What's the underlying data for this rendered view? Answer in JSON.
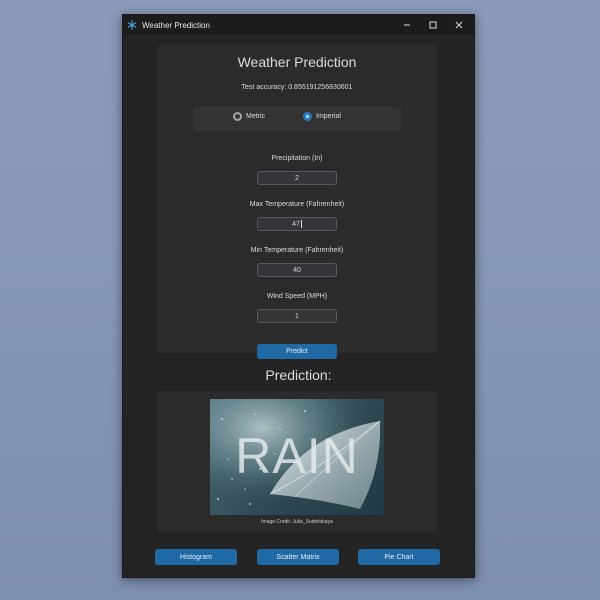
{
  "window": {
    "title": "Weather Prediction",
    "minimize_icon": "minimize-icon",
    "maximize_icon": "maximize-icon",
    "close_icon": "close-icon"
  },
  "form": {
    "heading": "Weather Prediction",
    "accuracy": "Test accuracy: 0.855191256830601",
    "units": {
      "options": [
        "Metric",
        "Imperial"
      ],
      "selected": "Imperial"
    },
    "fields": [
      {
        "label": "Precipitation (In)",
        "value": "2"
      },
      {
        "label": "Max Temperature (Fahrenheit)",
        "value": "47"
      },
      {
        "label": "Min Temperature (Fahrenheit)",
        "value": "40"
      },
      {
        "label": "Wind Speed (MPH)",
        "value": "1"
      }
    ],
    "predict_label": "Predict"
  },
  "prediction": {
    "heading": "Prediction:",
    "image_word": "RAIN",
    "credit": "Image Credit: Julia_Sudnitskaya"
  },
  "footer": {
    "buttons": [
      "Histogram",
      "Scatter Matrix",
      "Pie Chart"
    ]
  },
  "colors": {
    "accent": "#1f6aa5",
    "window_bg": "#242424",
    "panel_bg": "#2b2b2b",
    "desktop_bg": "#8a9ab8"
  }
}
